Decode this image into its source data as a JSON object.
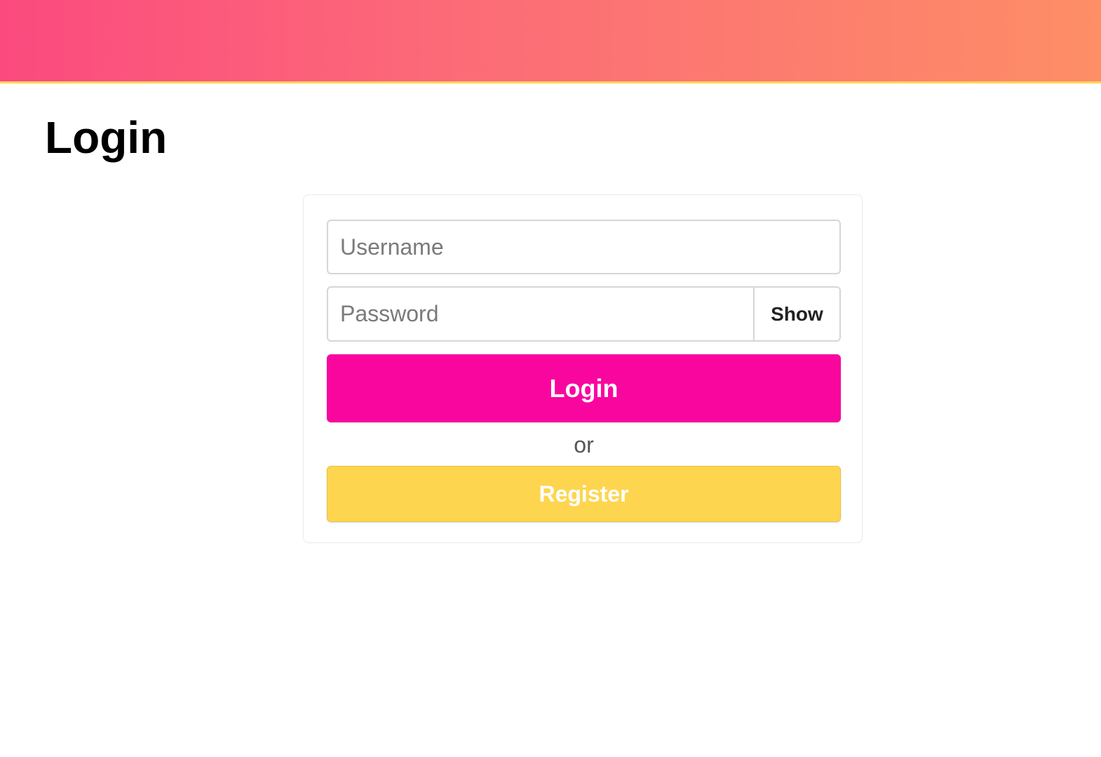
{
  "page": {
    "title": "Login"
  },
  "theme": {
    "banner_gradient_start": "#fb4a7f",
    "banner_gradient_end": "#fd8e66",
    "banner_underline": "#ffd45a",
    "login_button_color": "#f9069f",
    "register_button_color": "#fed54f"
  },
  "form": {
    "username_placeholder": "Username",
    "username_value": "",
    "password_placeholder": "Password",
    "password_value": "",
    "show_label": "Show",
    "login_label": "Login",
    "separator": "or",
    "register_label": "Register"
  }
}
